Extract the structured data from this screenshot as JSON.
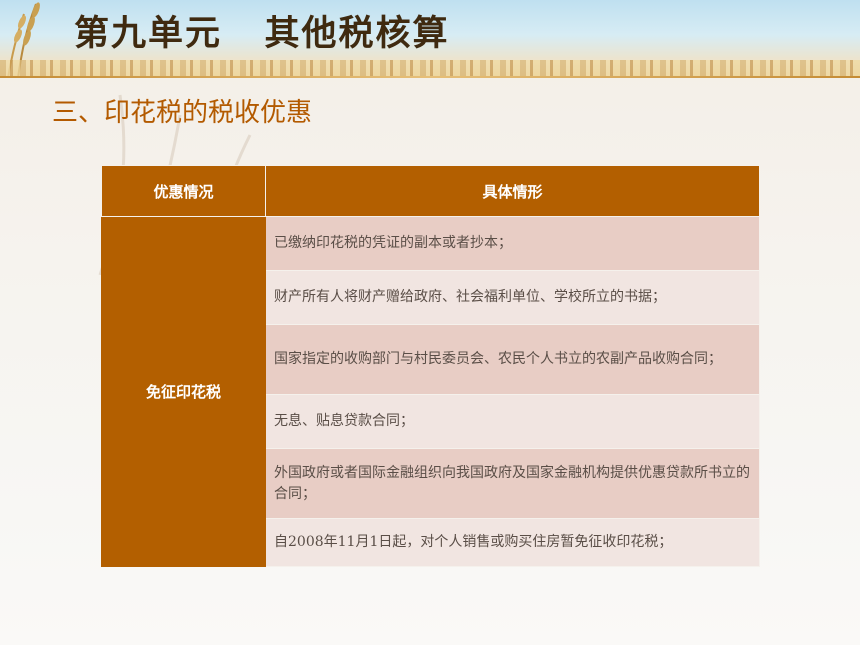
{
  "header": {
    "title": "第九单元   其他税核算"
  },
  "section": {
    "title": "三、印花税的税收优惠"
  },
  "table": {
    "columns": [
      "优惠情况",
      "具体情形"
    ],
    "category": "免征印花税",
    "items": [
      "已缴纳印花税的凭证的副本或者抄本；",
      "财产所有人将财产赠给政府、社会福利单位、学校所立的书据；",
      "国家指定的收购部门与村民委员会、农民个人书立的农副产品收购合同；",
      "无息、贴息贷款合同；",
      "外国政府或者国际金融组织向我国政府及国家金融机构提供优惠贷款所书立的合同；",
      "自2008年11月1日起，对个人销售或购买住房暂免征收印花税；"
    ]
  },
  "colors": {
    "accent": "#b35f00",
    "title_text": "#3f2a10",
    "section_text": "#b35a00"
  }
}
